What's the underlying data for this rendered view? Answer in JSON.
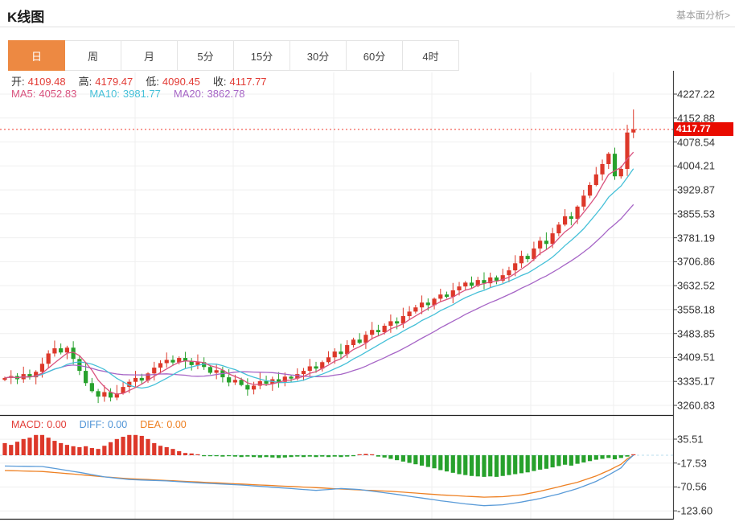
{
  "header": {
    "title": "K线图",
    "link": "基本面分析>"
  },
  "tabs": [
    {
      "label": "日",
      "active": true
    },
    {
      "label": "周",
      "active": false
    },
    {
      "label": "月",
      "active": false
    },
    {
      "label": "5分",
      "active": false
    },
    {
      "label": "15分",
      "active": false
    },
    {
      "label": "30分",
      "active": false
    },
    {
      "label": "60分",
      "active": false
    },
    {
      "label": "4时",
      "active": false
    }
  ],
  "ohlc_legend": [
    {
      "label": "开:",
      "value": "4109.48"
    },
    {
      "label": "高:",
      "value": "4179.47"
    },
    {
      "label": "低:",
      "value": "4090.45"
    },
    {
      "label": "收:",
      "value": "4117.77"
    }
  ],
  "ma_legend": [
    {
      "label": "MA5:",
      "value": "4052.83",
      "color": "#d9537f"
    },
    {
      "label": "MA10:",
      "value": "3981.77",
      "color": "#45c0d8"
    },
    {
      "label": "MA20:",
      "value": "3862.78",
      "color": "#a665c6"
    }
  ],
  "macd_legend": [
    {
      "label": "MACD:",
      "value": "0.00",
      "color": "#e23b35"
    },
    {
      "label": "DIFF:",
      "value": "0.00",
      "color": "#4f94d6"
    },
    {
      "label": "DEA:",
      "value": "0.00",
      "color": "#ee8022"
    }
  ],
  "current_price": "4117.77",
  "price_axis": [
    "4227.22",
    "4152.88",
    "4078.54",
    "4004.21",
    "3929.87",
    "3855.53",
    "3781.19",
    "3706.86",
    "3632.52",
    "3558.18",
    "3483.85",
    "3409.51",
    "3335.17",
    "3260.83"
  ],
  "macd_axis": [
    "35.51",
    "-17.53",
    "-70.56",
    "-123.60"
  ],
  "colors": {
    "candle_up": "#dd382a",
    "candle_down": "#27a12c",
    "ma5": "#d9537f",
    "ma10": "#45c0d8",
    "ma20": "#a665c6",
    "diff_line": "#5a9bd8",
    "dea_line": "#ee8022",
    "price_line": "#f03a2c",
    "tag_bg": "#e90b00",
    "tab_active": "#ed8942",
    "grid": "#efefef",
    "axis": "#444444"
  },
  "chart_data": {
    "type": "candlestick_with_macd",
    "title": "K线图",
    "period_selected": "日",
    "ohlc": {
      "open": 4109.48,
      "high": 4179.47,
      "low": 4090.45,
      "close": 4117.77
    },
    "ma": {
      "ma5": 4052.83,
      "ma10": 3981.77,
      "ma20": 3862.78
    },
    "price_axis_ticks": [
      4227.22,
      4152.88,
      4078.54,
      4004.21,
      3929.87,
      3855.53,
      3781.19,
      3706.86,
      3632.52,
      3558.18,
      3483.85,
      3409.51,
      3335.17,
      3260.83
    ],
    "macd_axis_ticks": [
      35.51,
      -17.53,
      -70.56,
      -123.6
    ],
    "current_price": 4117.77,
    "first_open": 3340,
    "closes": [
      3346,
      3352,
      3342,
      3358,
      3348,
      3365,
      3390,
      3422,
      3438,
      3425,
      3440,
      3405,
      3368,
      3330,
      3305,
      3288,
      3302,
      3285,
      3298,
      3318,
      3334,
      3346,
      3338,
      3360,
      3378,
      3392,
      3402,
      3394,
      3408,
      3398,
      3386,
      3395,
      3380,
      3362,
      3370,
      3348,
      3332,
      3340,
      3324,
      3310,
      3322,
      3336,
      3328,
      3342,
      3334,
      3350,
      3344,
      3358,
      3368,
      3382,
      3375,
      3395,
      3410,
      3428,
      3420,
      3448,
      3465,
      3455,
      3480,
      3495,
      3488,
      3508,
      3522,
      3515,
      3538,
      3552,
      3565,
      3580,
      3572,
      3592,
      3605,
      3598,
      3618,
      3630,
      3642,
      3632,
      3650,
      3640,
      3658,
      3648,
      3665,
      3680,
      3702,
      3725,
      3715,
      3748,
      3772,
      3762,
      3795,
      3822,
      3848,
      3840,
      3878,
      3912,
      3945,
      3978,
      4010,
      4042,
      3972,
      3995,
      4108,
      4117.77
    ],
    "last_candle": {
      "open": 4109.48,
      "high": 4179.47,
      "low": 4090.45,
      "close": 4117.77
    },
    "macd": {
      "values": {
        "macd": 0.0,
        "diff": 0.0,
        "dea": 0.0
      },
      "hist": [
        27,
        23,
        30,
        36,
        39,
        45,
        45,
        39,
        32,
        27,
        23,
        20,
        18,
        20,
        16,
        14,
        21,
        29,
        36,
        41,
        45,
        45,
        43,
        36,
        27,
        21,
        18,
        14,
        9,
        5,
        4,
        2,
        -1,
        -2,
        -1,
        -3,
        -2,
        -3,
        -4,
        -3,
        -4,
        -5,
        -4,
        -5,
        -6,
        -5,
        -4,
        -3,
        -4,
        -3,
        -4,
        -3,
        -4,
        -3,
        -4,
        -3,
        -2,
        2,
        3,
        2,
        -3,
        -5,
        -8,
        -11,
        -14,
        -17,
        -20,
        -23,
        -26,
        -29,
        -33,
        -36,
        -39,
        -42,
        -44,
        -46,
        -47,
        -48,
        -47,
        -48,
        -46,
        -44,
        -42,
        -40,
        -38,
        -35,
        -32,
        -30,
        -27,
        -24,
        -21,
        -23,
        -19,
        -16,
        -13,
        -10,
        -8,
        -6,
        -9,
        -6,
        -3,
        0
      ],
      "diff_points": [
        [
          0,
          -24
        ],
        [
          6,
          -25
        ],
        [
          12,
          -38
        ],
        [
          16,
          -48
        ],
        [
          20,
          -54
        ],
        [
          26,
          -57
        ],
        [
          32,
          -62
        ],
        [
          38,
          -66
        ],
        [
          44,
          -72
        ],
        [
          50,
          -78
        ],
        [
          54,
          -74
        ],
        [
          57,
          -76
        ],
        [
          62,
          -85
        ],
        [
          66,
          -93
        ],
        [
          70,
          -101
        ],
        [
          74,
          -108
        ],
        [
          77,
          -112
        ],
        [
          80,
          -110
        ],
        [
          83,
          -104
        ],
        [
          86,
          -96
        ],
        [
          89,
          -86
        ],
        [
          92,
          -74
        ],
        [
          95,
          -58
        ],
        [
          97,
          -44
        ],
        [
          99,
          -28
        ],
        [
          100,
          -12
        ],
        [
          101,
          0
        ]
      ],
      "dea_points": [
        [
          0,
          -34
        ],
        [
          6,
          -36
        ],
        [
          12,
          -43
        ],
        [
          16,
          -48
        ],
        [
          20,
          -52
        ],
        [
          26,
          -56
        ],
        [
          32,
          -60
        ],
        [
          38,
          -64
        ],
        [
          44,
          -68
        ],
        [
          50,
          -72
        ],
        [
          54,
          -75
        ],
        [
          57,
          -77
        ],
        [
          62,
          -80
        ],
        [
          66,
          -84
        ],
        [
          70,
          -88
        ],
        [
          74,
          -91
        ],
        [
          77,
          -93
        ],
        [
          80,
          -92
        ],
        [
          83,
          -88
        ],
        [
          86,
          -80
        ],
        [
          89,
          -70
        ],
        [
          92,
          -60
        ],
        [
          95,
          -46
        ],
        [
          97,
          -34
        ],
        [
          99,
          -20
        ],
        [
          100,
          -8
        ],
        [
          101,
          0
        ]
      ]
    }
  }
}
